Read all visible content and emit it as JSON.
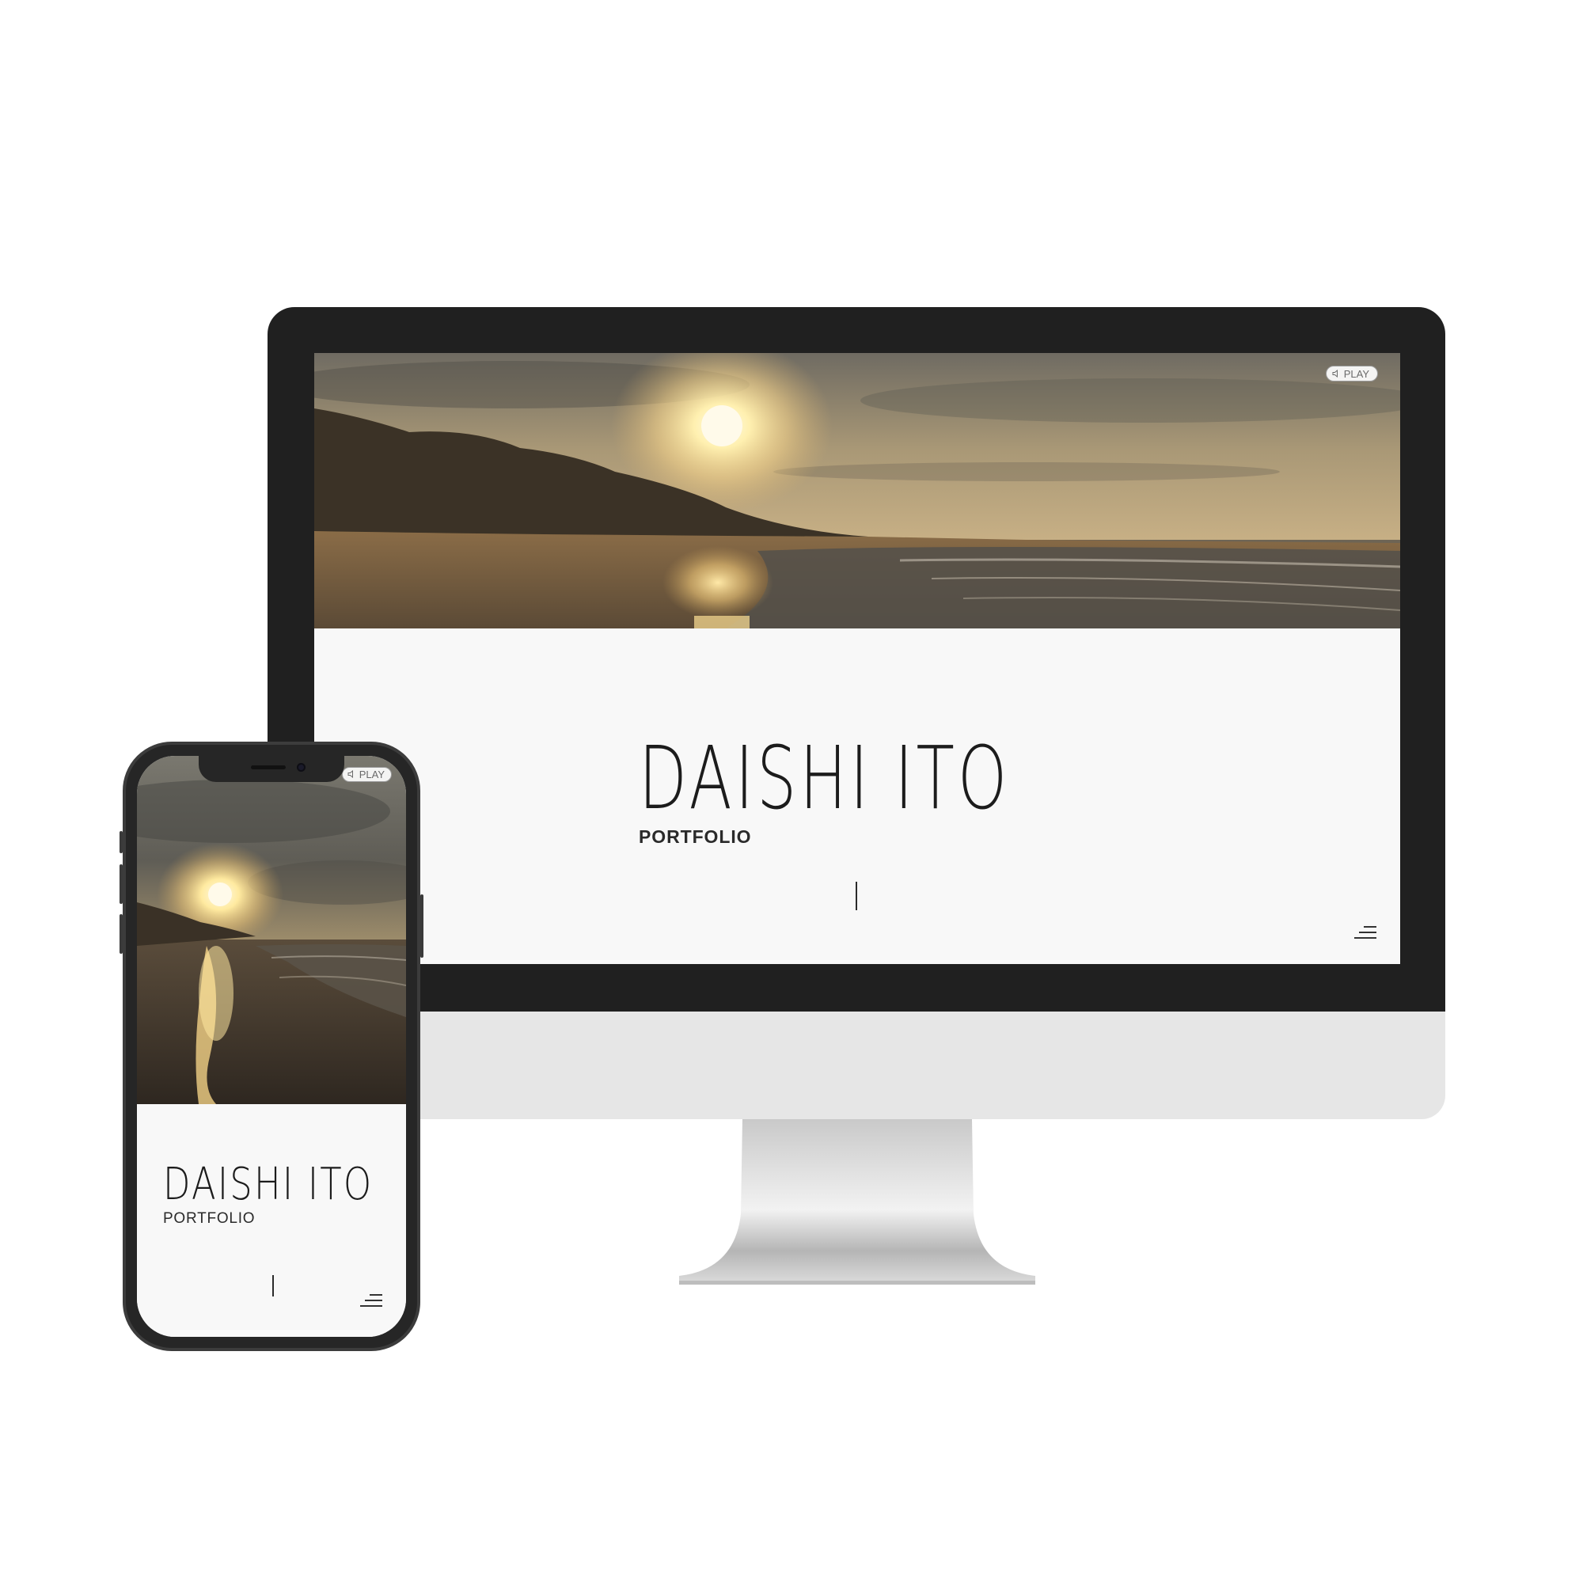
{
  "desktop": {
    "play_label": "PLAY",
    "logo_title": "DAISHI ITO",
    "logo_subtitle": "PORTFOLIO"
  },
  "mobile": {
    "play_label": "PLAY",
    "logo_title": "DAISHI ITO",
    "logo_subtitle": "PORTFOLIO"
  },
  "icons": {
    "play_icon": "speaker-icon",
    "menu_icon": "menu-icon"
  },
  "colors": {
    "bezel": "#202020",
    "page_background": "#f8f8f8",
    "text": "#1c1c1c",
    "sun": "#fff3c4"
  }
}
